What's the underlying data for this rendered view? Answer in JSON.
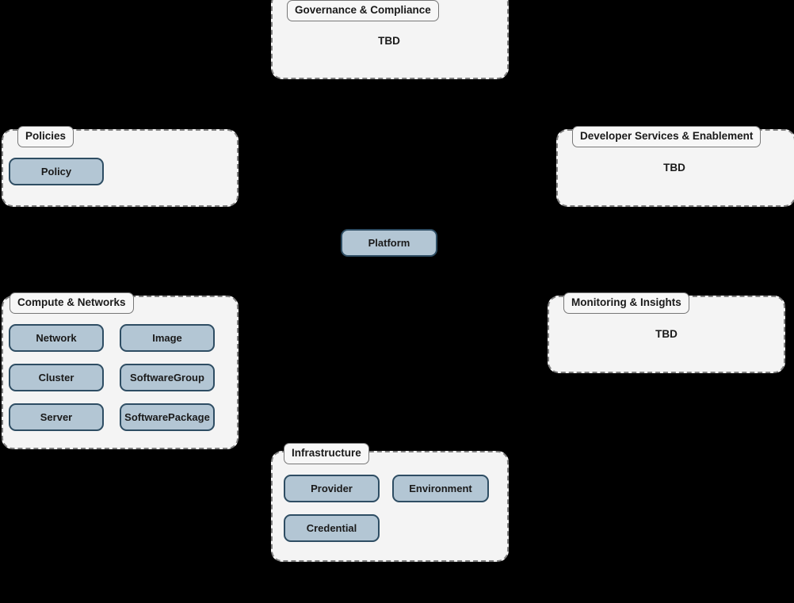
{
  "diagram": {
    "background_color": "#000000",
    "group_fill": "#f4f4f4",
    "group_border": "#808080",
    "node_fill": "#b3c6d4",
    "node_border": "#2e4d63",
    "label_fill": "#f7f7f7",
    "text_color": "#1a1a1a"
  },
  "groups": {
    "governance": {
      "label": "Governance & Compliance",
      "body_text": "TBD"
    },
    "policies": {
      "label": "Policies",
      "nodes": [
        {
          "label": "Policy"
        }
      ]
    },
    "developer_services": {
      "label": "Developer Services & Enablement",
      "body_text": "TBD"
    },
    "compute_networks": {
      "label": "Compute & Networks",
      "nodes": [
        {
          "label": "Network"
        },
        {
          "label": "Image"
        },
        {
          "label": "Cluster"
        },
        {
          "label": "SoftwareGroup"
        },
        {
          "label": "Server"
        },
        {
          "label": "SoftwarePackage"
        }
      ]
    },
    "monitoring": {
      "label": "Monitoring & Insights",
      "body_text": "TBD"
    },
    "infrastructure": {
      "label": "Infrastructure",
      "nodes": [
        {
          "label": "Provider"
        },
        {
          "label": "Environment"
        },
        {
          "label": "Credential"
        }
      ]
    }
  },
  "standalone_nodes": [
    {
      "label": "Platform"
    }
  ]
}
